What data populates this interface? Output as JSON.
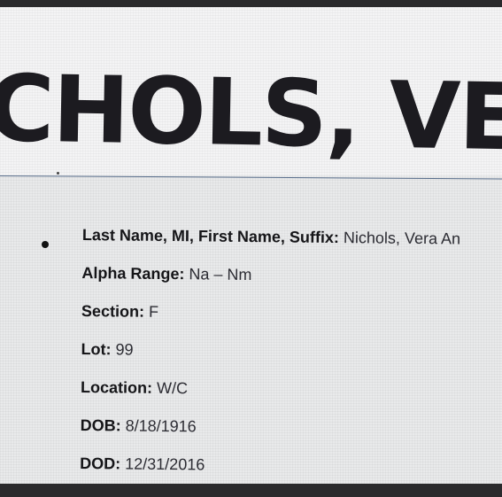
{
  "record": {
    "banner_name": "CHOLS, VEI",
    "fields": [
      {
        "label": "Last Name, MI, First Name, Suffix:",
        "value": "Nichols, Vera An"
      },
      {
        "label": "Alpha Range:",
        "value": "Na – Nm"
      },
      {
        "label": "Section:",
        "value": "F"
      },
      {
        "label": "Lot:",
        "value": "99"
      },
      {
        "label": "Location:",
        "value": "W/C"
      },
      {
        "label": "DOB:",
        "value": "8/18/1916"
      },
      {
        "label": "DOD:",
        "value": "12/31/2016"
      }
    ]
  }
}
